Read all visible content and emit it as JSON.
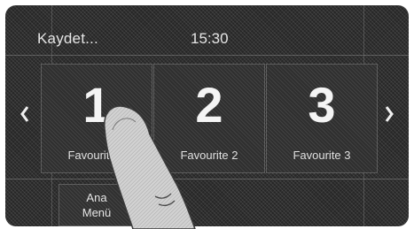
{
  "status_bar": {
    "title": "Kaydet...",
    "time": "15:30"
  },
  "navigation": {
    "prev_icon": "chevron-left-icon",
    "next_icon": "chevron-right-icon"
  },
  "favourites": [
    {
      "number": "1",
      "label": "Favourite 1"
    },
    {
      "number": "2",
      "label": "Favourite 2"
    },
    {
      "number": "3",
      "label": "Favourite 3"
    }
  ],
  "main_menu_button": {
    "line1": "Ana",
    "line2": "Menü"
  },
  "colors": {
    "screen_background": "#262626",
    "text": "#e6e6e6"
  }
}
